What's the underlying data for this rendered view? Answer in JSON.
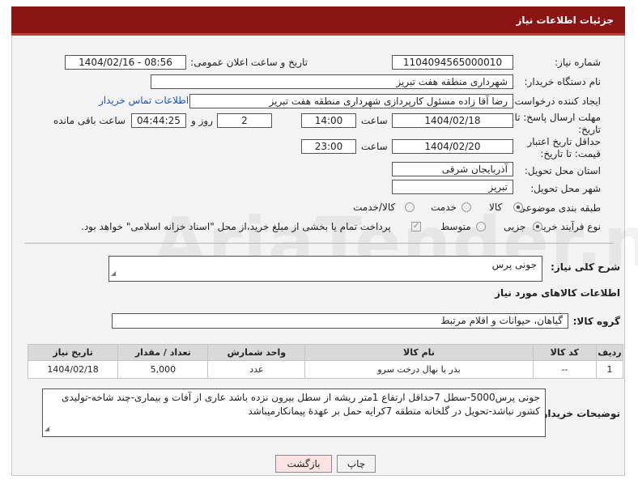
{
  "header": {
    "title": "جزئیات اطلاعات نیاز"
  },
  "form": {
    "need_number_label": "شماره نیاز:",
    "need_number": "1104094565000010",
    "announce_label": "تاریخ و ساعت اعلان عمومی:",
    "announce_value": "1404/02/16 - 08:56",
    "buyer_org_label": "نام دستگاه خریدار:",
    "buyer_org": "شهرداری منطقه هفت تبریز",
    "creator_label": "ایجاد کننده درخواست:",
    "creator": "رضا آقا زاده مسئول کارپردازی شهرداری منطقه هفت تبریز",
    "contact_link": "اطلاعات تماس خریدار",
    "deadline_label": "مهلت ارسال پاسخ: تا تاریخ:",
    "deadline_date": "1404/02/18",
    "hour_label": "ساعت",
    "deadline_time": "14:00",
    "days_value": "2",
    "days_label": "روز و",
    "remaining_time": "04:44:25",
    "remaining_label": "ساعت باقی مانده",
    "validity_label": "حداقل تاریخ اعتبار قیمت: تا تاریخ:",
    "validity_date": "1404/02/20",
    "validity_hour_label": "ساعت",
    "validity_time": "23:00",
    "province_label": "استان محل تحویل:",
    "province": "آذربایجان شرقی",
    "city_label": "شهر محل تحویل:",
    "city": "تبریز",
    "category_label": "طبقه بندی موضوعی:",
    "category_options": [
      "کالا",
      "خدمت",
      "کالا/خدمت"
    ],
    "process_label": "نوع فرآیند خرید :",
    "process_options": [
      "جزیی",
      "متوسط"
    ],
    "payment_note": "پرداخت تمام یا بخشی از مبلغ خرید،از محل \"اسناد خزانه اسلامی\" خواهد بود."
  },
  "summary": {
    "label": "شرح کلی نیاز:",
    "value": "جونی پرس"
  },
  "goods": {
    "section_title": "اطلاعات کالاهای مورد نیاز",
    "group_label": "گروه کالا:",
    "group_value": "گیاهان، حیوانات و اقلام مرتبط",
    "columns": [
      "ردیف",
      "کد کالا",
      "نام کالا",
      "واحد شمارش",
      "تعداد / مقدار",
      "تاریخ نیاز"
    ],
    "rows": [
      {
        "row": "1",
        "code": "--",
        "name": "بذر یا نهال درخت سرو",
        "unit": "عدد",
        "qty": "5,000",
        "date": "1404/02/18"
      }
    ]
  },
  "buyer_notes": {
    "label": "توضیحات خریدار:",
    "value": "جونی پرس5000-سطل 7حداقل ارتفاع 1متر ریشه از سطل بیرون نزده باشد عاری از آفات و بیماری-چند شاخه-تولیدی کشور نباشد-تحویل در گلخانه منطقه 7کرایه حمل بر عهدهٔ پیمانکارمیباشد"
  },
  "buttons": {
    "print": "چاپ",
    "back": "بازگشت"
  },
  "watermark": "AriaTender.neT",
  "colors": {
    "header_bg": "#8b1414",
    "link": "#1a56c8"
  }
}
